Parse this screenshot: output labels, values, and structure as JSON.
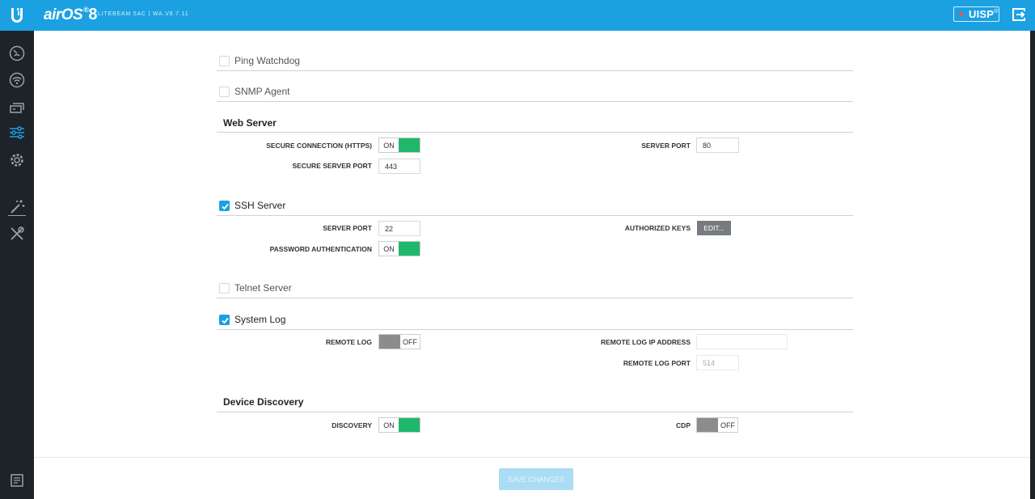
{
  "header": {
    "brand": "air",
    "brand_os": "OS",
    "brand_reg": "®",
    "brand_version": "8",
    "device_info": "LITEBEAM 5AC | WA.V8.7.11",
    "uisp_label": "UISP",
    "uisp_reg": "®"
  },
  "sidebar": {
    "items": [
      {
        "icon": "dashboard-icon",
        "active": false
      },
      {
        "icon": "wireless-icon",
        "active": false
      },
      {
        "icon": "network-icon",
        "active": false
      },
      {
        "icon": "services-icon",
        "active": true
      },
      {
        "icon": "system-icon",
        "active": false
      },
      {
        "icon": "tools-wand-icon",
        "active": false
      },
      {
        "icon": "tools-wrench-icon",
        "active": false
      }
    ],
    "bottom_icon": "log-icon"
  },
  "sections": {
    "ping_watchdog": {
      "title": "Ping Watchdog",
      "checked": false
    },
    "snmp_agent": {
      "title": "SNMP Agent",
      "checked": false
    },
    "web_server": {
      "title": "Web Server",
      "secure_connection_label": "SECURE CONNECTION (HTTPS)",
      "secure_connection_value": "ON",
      "server_port_label": "SERVER PORT",
      "server_port_value": "80",
      "secure_server_port_label": "SECURE SERVER PORT",
      "secure_server_port_value": "443"
    },
    "ssh_server": {
      "title": "SSH Server",
      "checked": true,
      "server_port_label": "SERVER PORT",
      "server_port_value": "22",
      "authorized_keys_label": "AUTHORIZED KEYS",
      "edit_label": "EDIT...",
      "password_auth_label": "PASSWORD AUTHENTICATION",
      "password_auth_value": "ON"
    },
    "telnet_server": {
      "title": "Telnet Server",
      "checked": false
    },
    "system_log": {
      "title": "System Log",
      "checked": true,
      "remote_log_label": "REMOTE LOG",
      "remote_log_value": "OFF",
      "remote_log_ip_label": "REMOTE LOG IP ADDRESS",
      "remote_log_ip_value": "",
      "remote_log_port_label": "REMOTE LOG PORT",
      "remote_log_port_value": "514"
    },
    "device_discovery": {
      "title": "Device Discovery",
      "discovery_label": "DISCOVERY",
      "discovery_value": "ON",
      "cdp_label": "CDP",
      "cdp_value": "OFF"
    }
  },
  "footer": {
    "save_label": "SAVE CHANGES"
  },
  "colors": {
    "accent": "#1ba1e2",
    "toggle_on": "#1fb86a",
    "toggle_off": "#8c8c8c",
    "sidebar": "#1d2329"
  }
}
